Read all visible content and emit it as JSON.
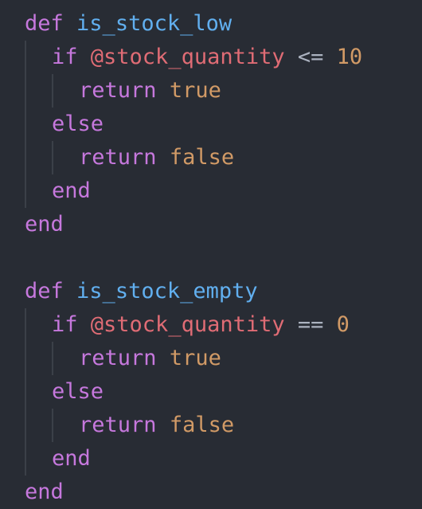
{
  "code": {
    "lines": [
      {
        "indent": 0,
        "tokens": [
          {
            "t": "def",
            "c": "kw"
          },
          {
            "t": " ",
            "c": ""
          },
          {
            "t": "is_stock_low",
            "c": "fn"
          }
        ]
      },
      {
        "indent": 1,
        "tokens": [
          {
            "t": "if",
            "c": "kw"
          },
          {
            "t": " ",
            "c": ""
          },
          {
            "t": "@stock_quantity",
            "c": "ivar"
          },
          {
            "t": " ",
            "c": ""
          },
          {
            "t": "<=",
            "c": "op"
          },
          {
            "t": " ",
            "c": ""
          },
          {
            "t": "10",
            "c": "num"
          }
        ]
      },
      {
        "indent": 2,
        "tokens": [
          {
            "t": "return",
            "c": "kw"
          },
          {
            "t": " ",
            "c": ""
          },
          {
            "t": "true",
            "c": "bool"
          }
        ]
      },
      {
        "indent": 1,
        "tokens": [
          {
            "t": "else",
            "c": "kw"
          }
        ]
      },
      {
        "indent": 2,
        "tokens": [
          {
            "t": "return",
            "c": "kw"
          },
          {
            "t": " ",
            "c": ""
          },
          {
            "t": "false",
            "c": "bool"
          }
        ]
      },
      {
        "indent": 1,
        "tokens": [
          {
            "t": "end",
            "c": "kw"
          }
        ]
      },
      {
        "indent": 0,
        "tokens": [
          {
            "t": "end",
            "c": "kw"
          }
        ]
      },
      {
        "indent": 0,
        "tokens": []
      },
      {
        "indent": 0,
        "tokens": [
          {
            "t": "def",
            "c": "kw"
          },
          {
            "t": " ",
            "c": ""
          },
          {
            "t": "is_stock_empty",
            "c": "fn"
          }
        ]
      },
      {
        "indent": 1,
        "tokens": [
          {
            "t": "if",
            "c": "kw"
          },
          {
            "t": " ",
            "c": ""
          },
          {
            "t": "@stock_quantity",
            "c": "ivar"
          },
          {
            "t": " ",
            "c": ""
          },
          {
            "t": "==",
            "c": "op"
          },
          {
            "t": " ",
            "c": ""
          },
          {
            "t": "0",
            "c": "num"
          }
        ]
      },
      {
        "indent": 2,
        "tokens": [
          {
            "t": "return",
            "c": "kw"
          },
          {
            "t": " ",
            "c": ""
          },
          {
            "t": "true",
            "c": "bool"
          }
        ]
      },
      {
        "indent": 1,
        "tokens": [
          {
            "t": "else",
            "c": "kw"
          }
        ]
      },
      {
        "indent": 2,
        "tokens": [
          {
            "t": "return",
            "c": "kw"
          },
          {
            "t": " ",
            "c": ""
          },
          {
            "t": "false",
            "c": "bool"
          }
        ]
      },
      {
        "indent": 1,
        "tokens": [
          {
            "t": "end",
            "c": "kw"
          }
        ]
      },
      {
        "indent": 0,
        "tokens": [
          {
            "t": "end",
            "c": "kw"
          }
        ]
      }
    ]
  },
  "theme": {
    "background": "#282c34",
    "keyword": "#c678dd",
    "function": "#61afef",
    "instance_variable": "#e06c75",
    "operator": "#abb2bf",
    "number": "#d19a66",
    "boolean": "#d19a66"
  }
}
